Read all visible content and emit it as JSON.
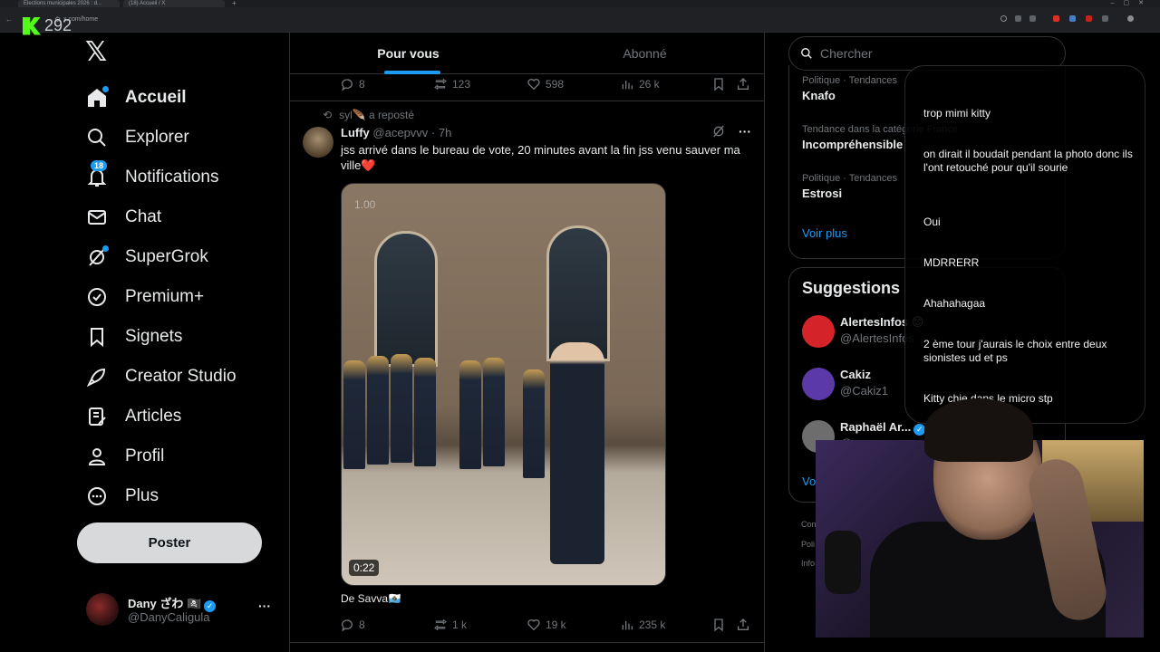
{
  "browser": {
    "tabs": [
      "Elections municipales 2026 : d...",
      "(18) Accueil / X"
    ],
    "url": "x.com/home",
    "kick_count": "292"
  },
  "sidebar": {
    "items": [
      {
        "label": "Accueil",
        "icon": "home-icon"
      },
      {
        "label": "Explorer",
        "icon": "search-icon"
      },
      {
        "label": "Notifications",
        "icon": "bell-icon",
        "badge": "18"
      },
      {
        "label": "Chat",
        "icon": "mail-icon"
      },
      {
        "label": "SuperGrok",
        "icon": "grok-icon"
      },
      {
        "label": "Premium+",
        "icon": "verified-icon"
      },
      {
        "label": "Signets",
        "icon": "bookmark-icon"
      },
      {
        "label": "Creator Studio",
        "icon": "rocket-icon"
      },
      {
        "label": "Articles",
        "icon": "article-icon"
      },
      {
        "label": "Profil",
        "icon": "person-icon"
      },
      {
        "label": "Plus",
        "icon": "more-circle-icon"
      }
    ],
    "post_button": "Poster",
    "user": {
      "name": "Dany ざわ 🏴‍☠️",
      "handle": "@DanyCaligula"
    }
  },
  "main": {
    "tabs": [
      "Pour vous",
      "Abonné"
    ],
    "prev_tweet_stats": {
      "replies": "8",
      "reposts": "123",
      "likes": "598",
      "views": "26 k"
    },
    "tweet": {
      "reposted_by": "syl🪶 a reposté",
      "name": "Luffy",
      "handle": "@acepvvv",
      "time": "· 7h",
      "text": "jss arrivé dans le bureau de vote, 20 minutes avant la fin jss venu sauver ma ville❤️",
      "video_speed": "1.00",
      "video_time": "0:22",
      "from": "De Savva🇸🇲",
      "stats": {
        "replies": "8",
        "reposts": "1 k",
        "likes": "19 k",
        "views": "235 k"
      }
    }
  },
  "right": {
    "search_placeholder": "Chercher",
    "trends": [
      {
        "category": "Politique · Tendances",
        "name": "Knafo"
      },
      {
        "category": "Tendance dans la catégorie France",
        "name": "Incompréhensible"
      },
      {
        "category": "Politique · Tendances",
        "name": "Estrosi"
      }
    ],
    "voir_plus": "Voir plus",
    "suggestions_title": "Suggestions",
    "suggestions": [
      {
        "name": "AlertesInfos 😊",
        "handle": "@AlertesInfos"
      },
      {
        "name": "Cakiz",
        "handle": "@Cakiz1"
      },
      {
        "name": "Raphaël Ar...",
        "handle": "@..."
      }
    ],
    "voir_plus_2": "Vo",
    "footer": [
      "Con",
      "Poli",
      "Info"
    ]
  },
  "chat": {
    "messages": [
      "trop mimi kitty",
      "on dirait il boudait pendant la photo donc ils l'ont retouché pour qu'il sourie",
      "Oui",
      "MDRRERR",
      "Ahahahagaa",
      "2 ème tour j'aurais le choix entre deux sionistes ud et ps",
      "Kitty chie dans le micro stp"
    ]
  },
  "colors": {
    "accent": "#1d9bf0",
    "kick": "#53fc18",
    "background": "#000000"
  }
}
